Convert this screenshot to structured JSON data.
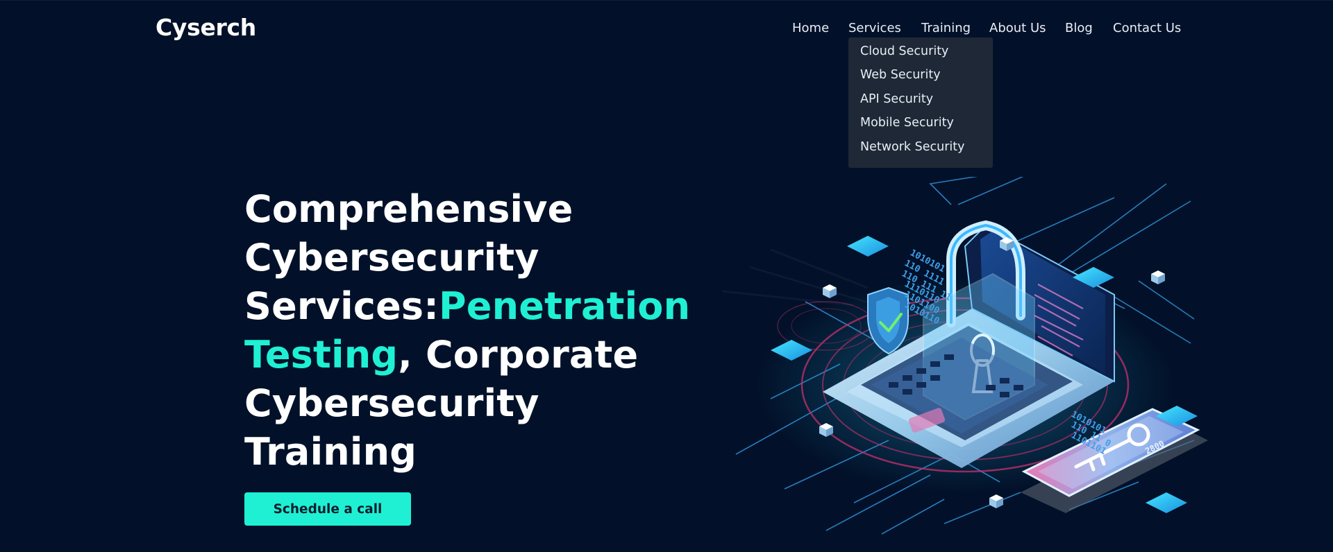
{
  "brand": {
    "name": "Cyserch"
  },
  "nav": {
    "items": [
      "Home",
      "Services",
      "Training",
      "About Us",
      "Blog",
      "Contact Us"
    ],
    "services_dropdown": [
      "Cloud Security",
      "Web Security",
      "API Security",
      "Mobile Security",
      "Network Security"
    ]
  },
  "hero": {
    "line1": "Comprehensive",
    "line2": "Cybersecurity",
    "line3_prefix": "Services:",
    "line3_accent": "Penetration",
    "line4_accent": "Testing",
    "line4_suffix": ", Corporate",
    "line5": "Cybersecurity",
    "line6": "Training",
    "cta_label": "Schedule a call"
  },
  "illustration": {
    "binary_top": [
      "1010101",
      "110 1111",
      "110 111 11",
      "1110110",
      "1101100",
      "1010110"
    ],
    "binary_bottom": [
      "1010101",
      "110 11 0",
      "1101101"
    ],
    "phone_code": "2800"
  },
  "colors": {
    "background": "#021129",
    "accent": "#1ff0d4",
    "dropdown_bg": "#1e2836"
  },
  "icons": [
    "padlock-icon",
    "shield-check-icon",
    "key-icon",
    "laptop-icon",
    "smartphone-icon"
  ]
}
